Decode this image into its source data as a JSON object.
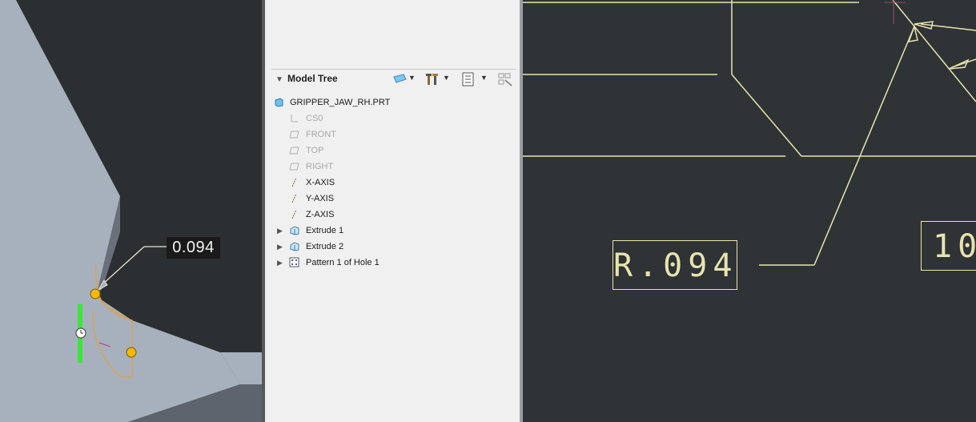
{
  "viewport": {
    "dimension_value": "0.094"
  },
  "model_tree": {
    "title": "Model Tree",
    "root": "GRIPPER_JAW_RH.PRT",
    "items": [
      {
        "label": "CS0",
        "icon": "csys-icon",
        "dimmed": true
      },
      {
        "label": "FRONT",
        "icon": "datum-plane-icon",
        "dimmed": true
      },
      {
        "label": "TOP",
        "icon": "datum-plane-icon",
        "dimmed": true
      },
      {
        "label": "RIGHT",
        "icon": "datum-plane-icon",
        "dimmed": true
      },
      {
        "label": "X-AXIS",
        "icon": "datum-axis-icon",
        "dimmed": false
      },
      {
        "label": "Y-AXIS",
        "icon": "datum-axis-icon",
        "dimmed": false
      },
      {
        "label": "Z-AXIS",
        "icon": "datum-axis-icon",
        "dimmed": false
      },
      {
        "label": "Extrude 1",
        "icon": "extrude-icon",
        "dimmed": false,
        "expandable": true
      },
      {
        "label": "Extrude 2",
        "icon": "extrude-icon",
        "dimmed": false,
        "expandable": true
      },
      {
        "label": "Pattern 1 of Hole 1",
        "icon": "pattern-icon",
        "dimmed": false,
        "expandable": true
      }
    ]
  },
  "drawing": {
    "radius_dimension": "R.094",
    "partial_dimension": "10"
  },
  "colors": {
    "model_face": "#a7b1bd",
    "model_side": "#646a73",
    "drawing_line": "#e8e4b0",
    "handle": "#f5b800",
    "drag_bar": "#39e639"
  }
}
